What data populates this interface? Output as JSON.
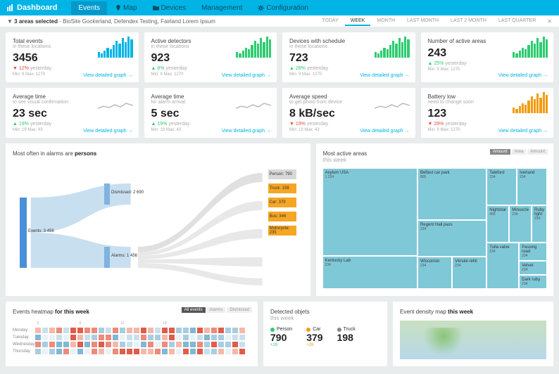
{
  "nav": {
    "brand": "Dashboard",
    "items": [
      {
        "label": "Events",
        "icon": ""
      },
      {
        "label": "Map",
        "icon": "pin"
      },
      {
        "label": "Devices",
        "icon": "folder"
      },
      {
        "label": "Management",
        "icon": ""
      },
      {
        "label": "Configuration",
        "icon": "cog"
      }
    ]
  },
  "subbar": {
    "areas_count": "3 areas selected",
    "areas_list": "BioSite Gockerland, Defendex Testing, Fairland Lorem Ipsum",
    "ranges": [
      "TODAY",
      "WEEK",
      "MONTH",
      "LAST MONTH",
      "LAST 2 MONTH",
      "LAST QUARTER"
    ],
    "active": "WEEK"
  },
  "kpis": [
    {
      "title": "Total events",
      "sub": "in these locations",
      "value": "3456",
      "change": "12%",
      "change_label": "yesterday",
      "dir": "down",
      "range": "Min: 9   Max: 1270",
      "spark": "blue",
      "link": "View detailed graph"
    },
    {
      "title": "Active detectors",
      "sub": "in these locations",
      "value": "923",
      "change": "8%",
      "change_label": "yesterday",
      "dir": "up",
      "range": "Min: 9   Max: 1270",
      "spark": "green",
      "link": "View detailed graph"
    },
    {
      "title": "Devices with schedule",
      "sub": "in these locations",
      "value": "723",
      "change": "28%",
      "change_label": "yesterday",
      "dir": "up",
      "range": "Min: 9   Max: 1270",
      "spark": "green",
      "link": "View detailed graph"
    },
    {
      "title": "Number of active areas",
      "sub": "",
      "value": "243",
      "change": "25%",
      "change_label": "yesterday",
      "dir": "up",
      "range": "Min: 9   Max: 1270",
      "spark": "green",
      "link": "View detailed graph"
    },
    {
      "title": "Average time",
      "sub": "to see visual confirmation",
      "value": "23 sec",
      "change": "19%",
      "change_label": "yesterday",
      "dir": "up",
      "range": "Min: 19   Max: 43",
      "spark": "line",
      "link": "View detailed graph"
    },
    {
      "title": "Average time",
      "sub": "for alarm arrival",
      "value": "5 sec",
      "change": "19%",
      "change_label": "yesterday",
      "dir": "up",
      "range": "Min: 19   Max: 43",
      "spark": "line",
      "link": "View detailed graph"
    },
    {
      "title": "Average speed",
      "sub": "to get photo from device",
      "value": "8 kB/sec",
      "change": "19%",
      "change_label": "yesterday",
      "dir": "down",
      "range": "Min: 19   Max: 43",
      "spark": "line",
      "link": "View detailed graph"
    },
    {
      "title": "Battery low",
      "sub": "need to change soon",
      "value": "123",
      "change": "28%",
      "change_label": "yesterday",
      "dir": "down",
      "range": "Min: 9   Max: 1270",
      "spark": "orange",
      "link": "View detailed graph"
    }
  ],
  "sankey": {
    "title_pre": "Most often in alarms are ",
    "title_b": "persons",
    "source": {
      "label": "Events: 3 456"
    },
    "mid": [
      {
        "label": "Dismissed: 2 690"
      },
      {
        "label": "Alarms: 1 456"
      }
    ],
    "targets": [
      {
        "label": "Person: 790",
        "color": "#d8d8d8"
      },
      {
        "label": "Truck: 198",
        "color": "#f5a623"
      },
      {
        "label": "Car: 379",
        "color": "#f5a623"
      },
      {
        "label": "Bus: 346",
        "color": "#f5a623"
      },
      {
        "label": "Motocycle: 235",
        "color": "#f5a623"
      }
    ]
  },
  "treemap": {
    "title": "Most active areas",
    "sub": "this week",
    "buttons": [
      "Amount",
      "Area",
      "Amount"
    ],
    "cells": [
      {
        "name": "Asylum USA",
        "val": "1 234"
      },
      {
        "name": "Belfast car park",
        "val": "805"
      },
      {
        "name": "Taleford",
        "val": "234"
      },
      {
        "name": "Iverland",
        "val": "234"
      },
      {
        "name": "Nightstar",
        "val": "456"
      },
      {
        "name": "Minuscle",
        "val": "234"
      },
      {
        "name": "Ruby light",
        "val": "234"
      },
      {
        "name": "Regent Hall pass",
        "val": "234"
      },
      {
        "name": "Wisconsin",
        "val": "234"
      },
      {
        "name": "Passing road",
        "val": "234"
      },
      {
        "name": "Kentucky Lab",
        "val": "234"
      },
      {
        "name": "Věrské réhli",
        "val": "234"
      },
      {
        "name": "Tulla valve",
        "val": "234"
      },
      {
        "name": "Velvet",
        "val": "234"
      },
      {
        "name": "Dark ruby",
        "val": "234"
      }
    ]
  },
  "heatmap": {
    "title_pre": "Events heatmap ",
    "title_b": "for this week",
    "buttons": [
      "All events",
      "Alarms",
      "Dismissed"
    ],
    "rows": [
      "Monday",
      "Tuesday",
      "Wednesday",
      "Thursday"
    ],
    "hours": 24
  },
  "detected": {
    "title": "Detected objets",
    "sub": "this week",
    "items": [
      {
        "label": "Person",
        "value": "790",
        "change": "+28",
        "color": "#2ecc71"
      },
      {
        "label": "Car",
        "value": "379",
        "change": "+28",
        "color": "#f39c12"
      },
      {
        "label": "Truck",
        "value": "198",
        "change": "",
        "color": "#888"
      }
    ]
  },
  "density": {
    "title_pre": "Event density map ",
    "title_b": "this week"
  },
  "chart_data": {
    "kpi_sparklines": [
      {
        "title": "Total events",
        "type": "bar",
        "values": [
          4,
          3,
          5,
          7,
          6,
          9,
          12,
          10,
          14,
          11,
          15,
          13
        ]
      },
      {
        "title": "Active detectors",
        "type": "bar",
        "values": [
          5,
          4,
          6,
          7,
          8,
          9,
          10,
          9,
          11,
          12,
          13,
          14
        ]
      },
      {
        "title": "Devices with schedule",
        "type": "bar",
        "values": [
          3,
          4,
          5,
          5,
          6,
          7,
          8,
          9,
          10,
          11,
          12,
          13
        ]
      },
      {
        "title": "Number of active areas",
        "type": "bar",
        "values": [
          4,
          5,
          6,
          7,
          6,
          8,
          9,
          10,
          11,
          12,
          13,
          14
        ]
      },
      {
        "title": "Average time visual",
        "type": "line",
        "values": [
          23,
          25,
          22,
          24,
          26,
          23,
          24,
          25
        ]
      },
      {
        "title": "Average time alarm",
        "type": "line",
        "values": [
          5,
          6,
          5,
          5,
          6,
          5,
          6,
          5
        ]
      },
      {
        "title": "Average speed",
        "type": "line",
        "values": [
          8,
          7,
          8,
          9,
          8,
          7,
          8,
          9
        ]
      },
      {
        "title": "Battery low",
        "type": "bar",
        "values": [
          3,
          4,
          3,
          5,
          4,
          6,
          7,
          8,
          9,
          10,
          11,
          12
        ]
      }
    ],
    "sankey": {
      "type": "sankey",
      "nodes": [
        "Events",
        "Dismissed",
        "Alarms",
        "Person",
        "Truck",
        "Car",
        "Bus",
        "Motocycle"
      ],
      "links": [
        {
          "source": "Events",
          "target": "Dismissed",
          "value": 2690
        },
        {
          "source": "Events",
          "target": "Alarms",
          "value": 1456
        },
        {
          "source": "Alarms",
          "target": "Person",
          "value": 790
        },
        {
          "source": "Alarms",
          "target": "Truck",
          "value": 198
        },
        {
          "source": "Alarms",
          "target": "Car",
          "value": 379
        },
        {
          "source": "Alarms",
          "target": "Bus",
          "value": 346
        },
        {
          "source": "Alarms",
          "target": "Motocycle",
          "value": 235
        }
      ]
    },
    "treemap": {
      "type": "treemap",
      "title": "Most active areas this week",
      "items": [
        {
          "name": "Asylum USA",
          "value": 1234
        },
        {
          "name": "Belfast car park",
          "value": 805
        },
        {
          "name": "Nightstar",
          "value": 456
        },
        {
          "name": "Taleford",
          "value": 234
        },
        {
          "name": "Iverland",
          "value": 234
        },
        {
          "name": "Minuscle",
          "value": 234
        },
        {
          "name": "Ruby light",
          "value": 234
        },
        {
          "name": "Regent Hall pass",
          "value": 234
        },
        {
          "name": "Wisconsin",
          "value": 234
        },
        {
          "name": "Passing road",
          "value": 234
        },
        {
          "name": "Kentucky Lab",
          "value": 234
        },
        {
          "name": "Věrské réhli",
          "value": 234
        },
        {
          "name": "Tulla valve",
          "value": 234
        },
        {
          "name": "Velvet",
          "value": 234
        },
        {
          "name": "Dark ruby",
          "value": 234
        }
      ]
    },
    "detected_objects": {
      "type": "bar",
      "categories": [
        "Person",
        "Car",
        "Truck"
      ],
      "values": [
        790,
        379,
        198
      ]
    }
  }
}
